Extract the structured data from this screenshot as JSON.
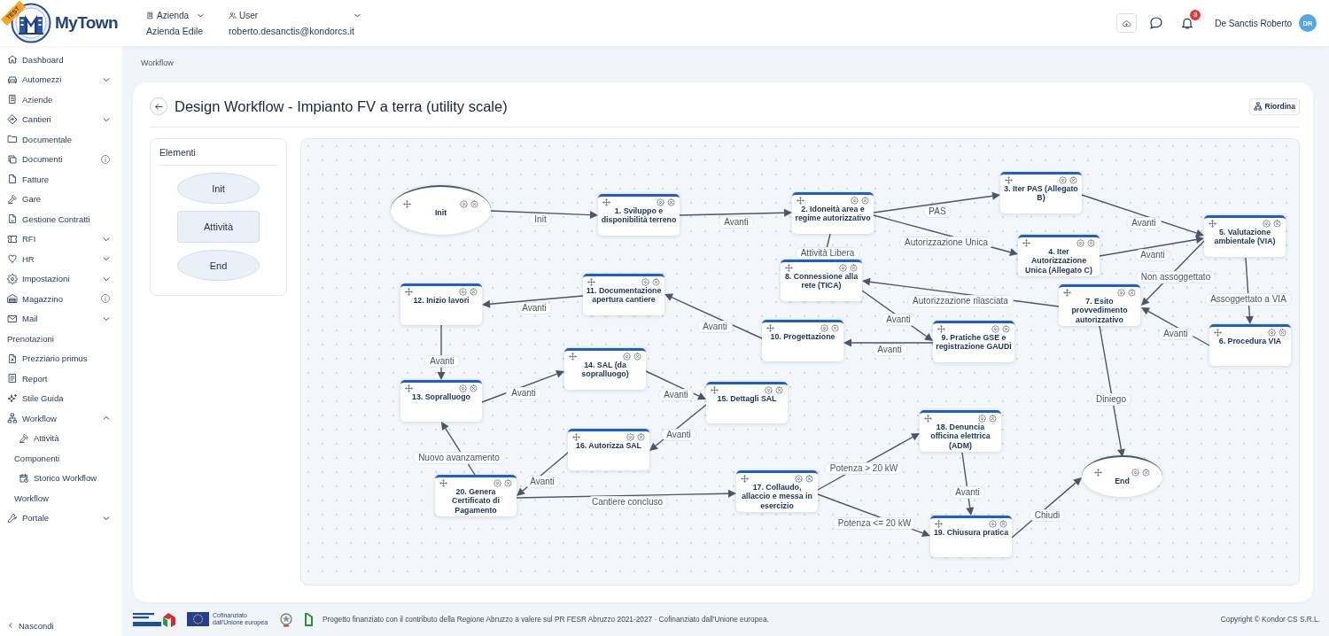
{
  "header": {
    "ribbon": "TEST",
    "app_name": "MyTown",
    "company": {
      "label": "Azienda",
      "value": "Azienda Edile"
    },
    "user": {
      "label": "User",
      "value": "roberto.desanctis@kondorcs.it"
    },
    "notifications": "3",
    "account": {
      "name": "De Sanctis Roberto",
      "initials": "DR"
    }
  },
  "sidebar": {
    "items": [
      {
        "kind": "link",
        "label": "Dashboard"
      },
      {
        "kind": "group",
        "label": "Automezzi",
        "expanded": false
      },
      {
        "kind": "link",
        "label": "Aziende"
      },
      {
        "kind": "group",
        "label": "Cantieri",
        "expanded": false
      },
      {
        "kind": "link",
        "label": "Documentale"
      },
      {
        "kind": "info",
        "label": "Documenti"
      },
      {
        "kind": "link",
        "label": "Fatture"
      },
      {
        "kind": "link",
        "label": "Gare"
      },
      {
        "kind": "link",
        "label": "Gestione Contratti"
      },
      {
        "kind": "group",
        "label": "RFI",
        "expanded": false
      },
      {
        "kind": "group",
        "label": "HR",
        "expanded": false
      },
      {
        "kind": "group",
        "label": "Impostazioni",
        "expanded": false
      },
      {
        "kind": "info",
        "label": "Magazzino"
      },
      {
        "kind": "group",
        "label": "Mail",
        "expanded": false
      },
      {
        "kind": "section",
        "label": "Prenotazioni"
      },
      {
        "kind": "link",
        "label": "Prezziario primus"
      },
      {
        "kind": "link",
        "label": "Report"
      },
      {
        "kind": "link",
        "label": "Stile Guida"
      },
      {
        "kind": "group",
        "label": "Workflow",
        "expanded": true,
        "children": [
          {
            "kind": "link",
            "label": "Attività"
          },
          {
            "kind": "section",
            "label": "Componenti"
          },
          {
            "kind": "link",
            "label": "Storico Workflow"
          },
          {
            "kind": "section",
            "label": "Workflow"
          }
        ]
      },
      {
        "kind": "group",
        "label": "Portale",
        "expanded": false
      }
    ],
    "collapse": "Nascondi"
  },
  "breadcrumb": "Workflow",
  "page": {
    "title": "Design Workflow - Impianto FV a terra (utility scale)",
    "reorder_button": "Riordina"
  },
  "palette": {
    "title": "Elementi",
    "items": [
      {
        "kind": "start",
        "label": "Init"
      },
      {
        "kind": "activity",
        "label": "Attività"
      },
      {
        "kind": "end",
        "label": "End"
      }
    ]
  },
  "diagram": {
    "nodes": [
      {
        "kind": "start",
        "label": "Init"
      },
      {
        "kind": "activity",
        "label": "1. Sviluppo e disponibilità terreno"
      },
      {
        "kind": "activity",
        "label": "2. Idoneità area e regime autorizzativo"
      },
      {
        "kind": "activity",
        "label": "3. Iter PAS (Allegato B)"
      },
      {
        "kind": "activity",
        "label": "12. Inizio lavori"
      },
      {
        "kind": "activity",
        "label": "11. Documentazione apertura cantiere"
      },
      {
        "kind": "activity",
        "label": "8. Connessione alla rete (TICA)"
      },
      {
        "kind": "activity",
        "label": "4. Iter Autorizzazione Unica (Allegato C)"
      },
      {
        "kind": "activity",
        "label": "5. Valutazione ambientale (VIA)"
      },
      {
        "kind": "activity",
        "label": "7. Esito provvedimento autorizzativo"
      },
      {
        "kind": "activity",
        "label": "14. SAL (da sopralluogo)"
      },
      {
        "kind": "activity",
        "label": "10. Progettazione"
      },
      {
        "kind": "activity",
        "label": "9. Pratiche GSE e registrazione GAUDÌ"
      },
      {
        "kind": "activity",
        "label": "6. Procedura VIA"
      },
      {
        "kind": "activity",
        "label": "13. Sopralluogo"
      },
      {
        "kind": "activity",
        "label": "15. Dettagli SAL"
      },
      {
        "kind": "activity",
        "label": "16. Autorizza SAL"
      },
      {
        "kind": "activity",
        "label": "18. Denuncia officina elettrica (ADM)"
      },
      {
        "kind": "activity",
        "label": "20. Genera Certificato di Pagamento"
      },
      {
        "kind": "activity",
        "label": "17. Collaudo, allaccio e messa in esercizio"
      },
      {
        "kind": "end",
        "label": "End"
      },
      {
        "kind": "activity",
        "label": "19. Chiusura pratica"
      }
    ],
    "edges": [
      {
        "label": "Init"
      },
      {
        "label": "Avanti"
      },
      {
        "label": "PAS"
      },
      {
        "label": "Avanti"
      },
      {
        "label": "Attività Libera"
      },
      {
        "label": "Autorizzazione Unica"
      },
      {
        "label": "Avanti"
      },
      {
        "label": "Non assoggettato"
      },
      {
        "label": "Avanti"
      },
      {
        "label": "Autorizzazione rilasciata"
      },
      {
        "label": "Assoggettato a VIA"
      },
      {
        "label": "Avanti"
      },
      {
        "label": "Avanti"
      },
      {
        "label": "Avanti"
      },
      {
        "label": "Avanti"
      },
      {
        "label": "Avanti"
      },
      {
        "label": "Avanti"
      },
      {
        "label": "Avanti"
      },
      {
        "label": "Diniego"
      },
      {
        "label": "Avanti"
      },
      {
        "label": "Nuovo avanzamento"
      },
      {
        "label": "Avanti"
      },
      {
        "label": "Potenza > 20 kW"
      },
      {
        "label": "Cantiere concluso"
      },
      {
        "label": "Avanti"
      },
      {
        "label": "Potenza <= 20 kW"
      },
      {
        "label": "Chiudi"
      }
    ]
  },
  "footer": {
    "eu_label": "Cofinanziato dall'Unione europea",
    "note": "Progetto finanziato con il contributo della Regione Abruzzo a valere sul PR FESR Abruzzo 2021-2027 · Cofinanziato dall'Unione europea.",
    "copyright": "Copyright © Kondor CS S.R.L."
  }
}
